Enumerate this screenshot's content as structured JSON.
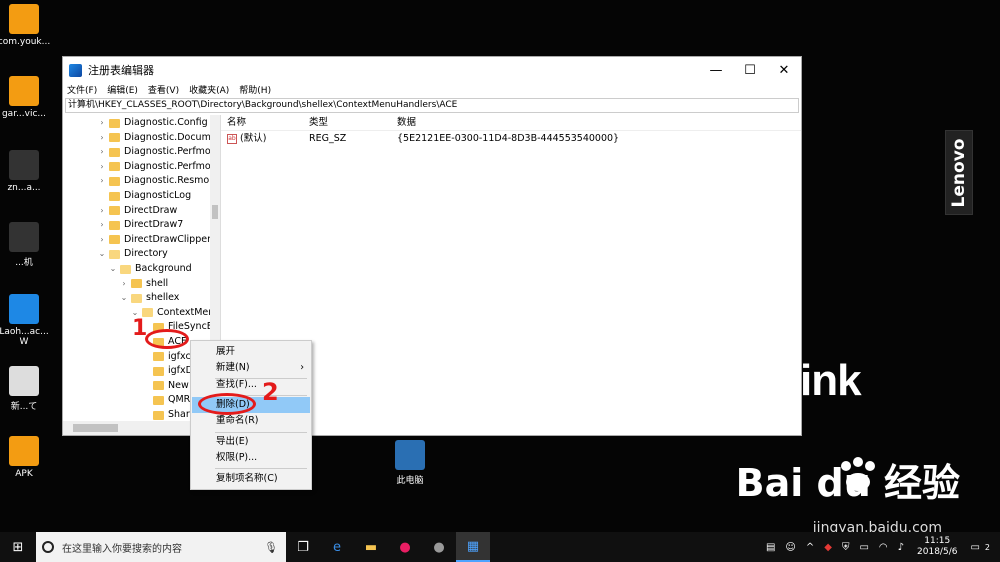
{
  "desktop": {
    "icons": [
      {
        "label": "com.youk...",
        "color": "#f39c12"
      },
      {
        "label": "gar...vic...",
        "color": "#f39c12"
      },
      {
        "label": "zn...a...",
        "color": "#333333"
      },
      {
        "label": "...机",
        "color": "#333333"
      },
      {
        "label": "Laoh...ac... W",
        "color": "#1e88e5"
      },
      {
        "label": "新...て",
        "color": "#dddddd"
      },
      {
        "label": "APK",
        "color": "#f39c12"
      }
    ],
    "this_pc_label": "此电脑",
    "lenovo_logo": "Lenovo",
    "think_logo": "ink",
    "baidu_logo": "Bai du 经验",
    "baidu_url": "jingyan.baidu.com"
  },
  "window": {
    "title": "注册表编辑器",
    "controls": {
      "minimize": "—",
      "maximize": "☐",
      "close": "✕"
    },
    "menu": [
      "文件(F)",
      "编辑(E)",
      "查看(V)",
      "收藏夹(A)",
      "帮助(H)"
    ],
    "address": "计算机\\HKEY_CLASSES_ROOT\\Directory\\Background\\shellex\\ContextMenuHandlers\\ACE"
  },
  "tree": [
    {
      "label": "Diagnostic.Config",
      "indent": 0,
      "caret": ">"
    },
    {
      "label": "Diagnostic.Document",
      "indent": 0,
      "caret": ">"
    },
    {
      "label": "Diagnostic.Perfmon.C",
      "indent": 0,
      "caret": ">"
    },
    {
      "label": "Diagnostic.Perfmon.D",
      "indent": 0,
      "caret": ">"
    },
    {
      "label": "Diagnostic.Resmon.C",
      "indent": 0,
      "caret": ">"
    },
    {
      "label": "DiagnosticLog",
      "indent": 0,
      "caret": ""
    },
    {
      "label": "DirectDraw",
      "indent": 0,
      "caret": ">"
    },
    {
      "label": "DirectDraw7",
      "indent": 0,
      "caret": ">"
    },
    {
      "label": "DirectDrawClipper",
      "indent": 0,
      "caret": ">"
    },
    {
      "label": "Directory",
      "indent": 0,
      "caret": "v"
    },
    {
      "label": "Background",
      "indent": 1,
      "caret": "v"
    },
    {
      "label": "shell",
      "indent": 2,
      "caret": ">"
    },
    {
      "label": "shellex",
      "indent": 2,
      "caret": "v"
    },
    {
      "label": "ContextMenu",
      "indent": 3,
      "caret": "v"
    },
    {
      "label": "FileSyncEx",
      "indent": 4,
      "caret": ""
    },
    {
      "label": "ACE",
      "indent": 4,
      "caret": ""
    },
    {
      "label": "igfxcu",
      "indent": 4,
      "caret": ""
    },
    {
      "label": "igfxDT",
      "indent": 4,
      "caret": ""
    },
    {
      "label": "New",
      "indent": 4,
      "caret": ""
    },
    {
      "label": "QMRe",
      "indent": 4,
      "caret": ""
    },
    {
      "label": "Sharin",
      "indent": 4,
      "caret": ""
    }
  ],
  "values": {
    "headers": [
      "名称",
      "类型",
      "数据"
    ],
    "rows": [
      {
        "name": "(默认)",
        "type": "REG_SZ",
        "data": "{5E2121EE-0300-11D4-8D3B-444553540000}"
      }
    ]
  },
  "context_menu": [
    {
      "label": "展开",
      "type": "item"
    },
    {
      "label": "新建(N)",
      "type": "submenu"
    },
    {
      "label": "查找(F)...",
      "type": "item"
    },
    {
      "label": "删除(D)",
      "type": "highlight"
    },
    {
      "label": "重命名(R)",
      "type": "item"
    },
    {
      "label": "导出(E)",
      "type": "item"
    },
    {
      "label": "权限(P)...",
      "type": "item"
    },
    {
      "label": "复制项名称(C)",
      "type": "item"
    }
  ],
  "annotations": {
    "one": "1",
    "two": "2"
  },
  "taskbar": {
    "search_placeholder": "在这里输入你要搜索的内容",
    "time": "11:15",
    "date": "2018/5/6",
    "notification_count": "2"
  }
}
